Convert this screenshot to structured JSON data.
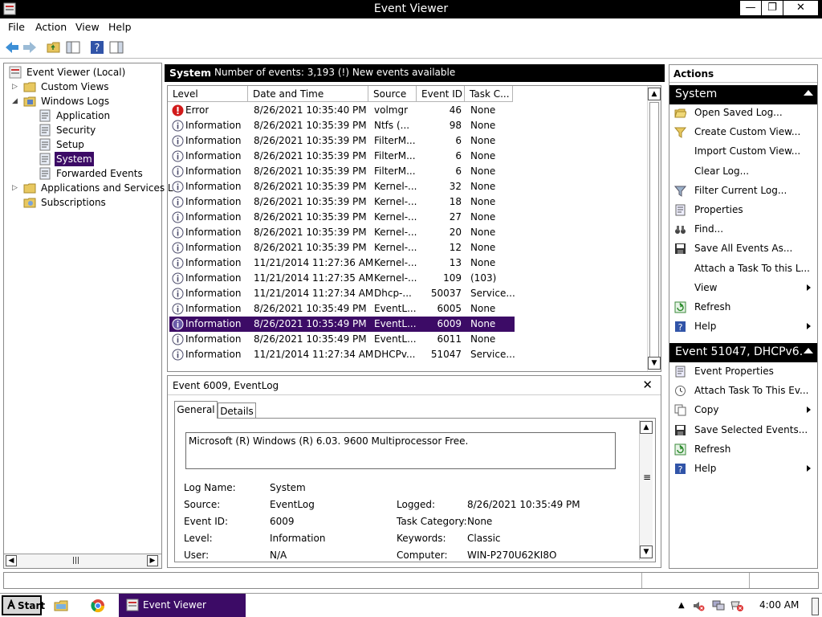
{
  "window": {
    "title": "Event Viewer",
    "min": "—",
    "max": "❐",
    "close": "✕"
  },
  "menu": [
    "File",
    "Action",
    "View",
    "Help"
  ],
  "tree": {
    "root": "Event Viewer (Local)",
    "custom_views": "Custom Views",
    "windows_logs": "Windows Logs",
    "application": "Application",
    "security": "Security",
    "setup": "Setup",
    "system": "System",
    "forwarded": "Forwarded Events",
    "apps_services": "Applications and Services Lo",
    "subscriptions": "Subscriptions"
  },
  "center": {
    "title": "System",
    "count": "Number of events: 3,193 (!) New events available",
    "columns": [
      "Level",
      "Date and Time",
      "Source",
      "Event ID",
      "Task C..."
    ],
    "rows": [
      {
        "level": "Error",
        "date": "8/26/2021 10:35:40 PM",
        "source": "volmgr",
        "id": "46",
        "task": "None",
        "kind": "error"
      },
      {
        "level": "Information",
        "date": "8/26/2021 10:35:39 PM",
        "source": "Ntfs (...",
        "id": "98",
        "task": "None",
        "kind": "info"
      },
      {
        "level": "Information",
        "date": "8/26/2021 10:35:39 PM",
        "source": "FilterM...",
        "id": "6",
        "task": "None",
        "kind": "info"
      },
      {
        "level": "Information",
        "date": "8/26/2021 10:35:39 PM",
        "source": "FilterM...",
        "id": "6",
        "task": "None",
        "kind": "info"
      },
      {
        "level": "Information",
        "date": "8/26/2021 10:35:39 PM",
        "source": "FilterM...",
        "id": "6",
        "task": "None",
        "kind": "info"
      },
      {
        "level": "Information",
        "date": "8/26/2021 10:35:39 PM",
        "source": "Kernel-...",
        "id": "32",
        "task": "None",
        "kind": "info"
      },
      {
        "level": "Information",
        "date": "8/26/2021 10:35:39 PM",
        "source": "Kernel-...",
        "id": "18",
        "task": "None",
        "kind": "info"
      },
      {
        "level": "Information",
        "date": "8/26/2021 10:35:39 PM",
        "source": "Kernel-...",
        "id": "27",
        "task": "None",
        "kind": "info"
      },
      {
        "level": "Information",
        "date": "8/26/2021 10:35:39 PM",
        "source": "Kernel-...",
        "id": "20",
        "task": "None",
        "kind": "info"
      },
      {
        "level": "Information",
        "date": "8/26/2021 10:35:39 PM",
        "source": "Kernel-...",
        "id": "12",
        "task": "None",
        "kind": "info"
      },
      {
        "level": "Information",
        "date": "11/21/2014 11:27:36 AM",
        "source": "Kernel-...",
        "id": "13",
        "task": "None",
        "kind": "info"
      },
      {
        "level": "Information",
        "date": "11/21/2014 11:27:35 AM",
        "source": "Kernel-...",
        "id": "109",
        "task": "(103)",
        "kind": "info"
      },
      {
        "level": "Information",
        "date": "11/21/2014 11:27:34 AM",
        "source": "Dhcp-...",
        "id": "50037",
        "task": "Service...",
        "kind": "info"
      },
      {
        "level": "Information",
        "date": "8/26/2021 10:35:49 PM",
        "source": "EventL...",
        "id": "6005",
        "task": "None",
        "kind": "info"
      },
      {
        "level": "Information",
        "date": "8/26/2021 10:35:49 PM",
        "source": "EventL...",
        "id": "6009",
        "task": "None",
        "kind": "info",
        "selected": true
      },
      {
        "level": "Information",
        "date": "8/26/2021 10:35:49 PM",
        "source": "EventL...",
        "id": "6011",
        "task": "None",
        "kind": "info"
      },
      {
        "level": "Information",
        "date": "11/21/2014 11:27:34 AM",
        "source": "DHCPv...",
        "id": "51047",
        "task": "Service...",
        "kind": "info"
      }
    ]
  },
  "detail": {
    "title": "Event 6009, EventLog",
    "tab_general": "General",
    "tab_details": "Details",
    "description": "Microsoft (R) Windows (R) 6.03. 9600  Multiprocessor Free.",
    "log_name_label": "Log Name:",
    "log_name": "System",
    "source_label": "Source:",
    "source": "EventLog",
    "logged_label": "Logged:",
    "logged": "8/26/2021 10:35:49 PM",
    "event_id_label": "Event ID:",
    "event_id": "6009",
    "task_cat_label": "Task Category:",
    "task_cat": "None",
    "level_label": "Level:",
    "level": "Information",
    "keywords_label": "Keywords:",
    "keywords": "Classic",
    "user_label": "User:",
    "user": "N/A",
    "computer_label": "Computer:",
    "computer": "WIN-P270U62KI8O"
  },
  "actions": {
    "header": "Actions",
    "section1": "System",
    "items1": [
      {
        "label": "Open Saved Log...",
        "icon": "folder-open-icon"
      },
      {
        "label": "Create Custom View...",
        "icon": "filter-star-icon"
      },
      {
        "label": "Import Custom View...",
        "icon": ""
      },
      {
        "label": "Clear Log...",
        "icon": ""
      },
      {
        "label": "Filter Current Log...",
        "icon": "filter-icon"
      },
      {
        "label": "Properties",
        "icon": "properties-icon"
      },
      {
        "label": "Find...",
        "icon": "binoculars-icon"
      },
      {
        "label": "Save All Events As...",
        "icon": "save-icon"
      },
      {
        "label": "Attach a Task To this L...",
        "icon": ""
      },
      {
        "label": "View",
        "icon": "",
        "submenu": true
      },
      {
        "label": "Refresh",
        "icon": "refresh-icon"
      },
      {
        "label": "Help",
        "icon": "help-icon",
        "submenu": true
      }
    ],
    "section2": "Event 51047, DHCPv6...",
    "items2": [
      {
        "label": "Event Properties",
        "icon": "properties-icon"
      },
      {
        "label": "Attach Task To This Ev...",
        "icon": "clock-task-icon"
      },
      {
        "label": "Copy",
        "icon": "copy-icon",
        "submenu": true
      },
      {
        "label": "Save Selected Events...",
        "icon": "save-icon"
      },
      {
        "label": "Refresh",
        "icon": "refresh-icon"
      },
      {
        "label": "Help",
        "icon": "help-icon",
        "submenu": true
      }
    ]
  },
  "taskbar": {
    "start": "Start",
    "task": "Event Viewer",
    "clock": "4:00 AM"
  },
  "colors": {
    "selection": "#3c0b66",
    "info": "#4a4a9a",
    "error": "#d11a1a"
  }
}
